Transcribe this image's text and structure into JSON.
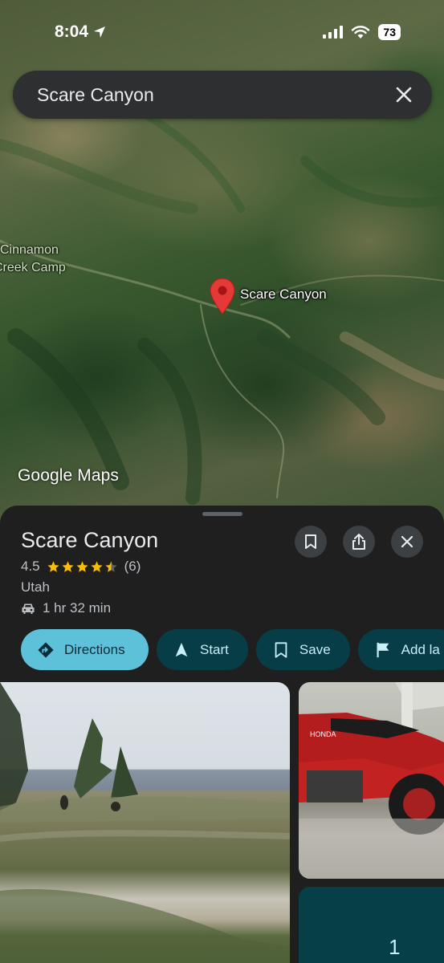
{
  "status_bar": {
    "time": "8:04",
    "battery": "73"
  },
  "search": {
    "query": "Scare Canyon"
  },
  "map": {
    "labels": [
      "Cinnamon",
      "Creek Camp"
    ],
    "pin_label": "Scare Canyon",
    "attribution": "Google Maps"
  },
  "place": {
    "name": "Scare Canyon",
    "rating": "4.5",
    "stars": 4.5,
    "review_count": "(6)",
    "region": "Utah",
    "drive_time": "1 hr 32 min"
  },
  "actions": {
    "directions": "Directions",
    "start": "Start",
    "save": "Save",
    "add_label": "Add la"
  },
  "panel": {
    "fragment": "1"
  },
  "colors": {
    "accent": "#5dc1da",
    "chip_dark": "#073d47",
    "pin": "#e53935",
    "star": "#fbbc04"
  }
}
